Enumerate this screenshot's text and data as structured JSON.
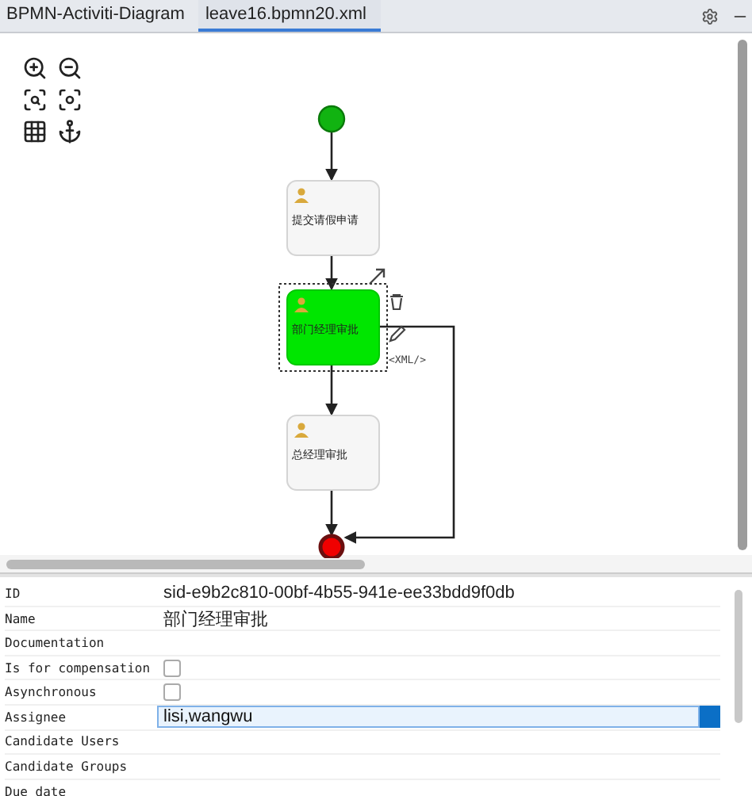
{
  "tabs": [
    {
      "label": "BPMN-Activiti-Diagram",
      "selected": false
    },
    {
      "label": "leave16.bpmn20.xml",
      "selected": true
    }
  ],
  "diagram": {
    "nodes": [
      {
        "kind": "start",
        "selected": false
      },
      {
        "kind": "task",
        "label": "提交请假申请",
        "selected": false
      },
      {
        "kind": "task",
        "label": "部门经理审批",
        "selected": true
      },
      {
        "kind": "task",
        "label": "总经理审批",
        "selected": false
      },
      {
        "kind": "end",
        "selected": false
      }
    ],
    "xml_link": "<XML/>"
  },
  "properties": [
    {
      "kind": "text",
      "label": "ID",
      "value": "sid-e9b2c810-00bf-4b55-941e-ee33bdd9f0db"
    },
    {
      "kind": "text",
      "label": "Name",
      "value": "部门经理审批"
    },
    {
      "kind": "text",
      "label": "Documentation"
    },
    {
      "kind": "checkbox",
      "label": "Is for compensation",
      "checked": false
    },
    {
      "kind": "checkbox",
      "label": "Asynchronous",
      "checked": false
    },
    {
      "kind": "input",
      "label": "Assignee",
      "value": "lisi,wangwu"
    },
    {
      "kind": "text",
      "label": "Candidate Users"
    },
    {
      "kind": "text",
      "label": "Candidate Groups"
    },
    {
      "kind": "text",
      "label": "Due date"
    }
  ]
}
